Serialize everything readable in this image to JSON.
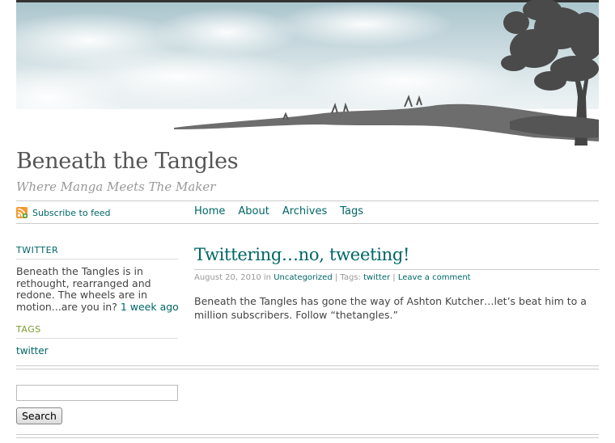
{
  "site": {
    "title": "Beneath the Tangles",
    "tagline": "Where Manga Meets The Maker"
  },
  "feed": {
    "label": "Subscribe to feed",
    "icon": "rss-feed-icon"
  },
  "nav": {
    "items": [
      {
        "label": "Home"
      },
      {
        "label": "About"
      },
      {
        "label": "Archives"
      },
      {
        "label": "Tags"
      }
    ]
  },
  "sidebar": {
    "twitter": {
      "title": "TWITTER",
      "text": "Beneath the Tangles is in rethought, rearranged and redone. The wheels are in motion...are you in?",
      "time_link": "1 week ago"
    },
    "tags": {
      "title": "TAGS",
      "items": [
        {
          "label": "twitter"
        }
      ]
    }
  },
  "post": {
    "title": "Twittering…no, tweeting!",
    "date": "August 20, 2010",
    "in_label": "in",
    "category": "Uncategorized",
    "tags_label": "| Tags:",
    "tag": "twitter",
    "comment_link": "Leave a comment",
    "body": "Beneath the Tangles has gone the way of Ashton Kutcher…let’s beat him to a million subscribers.    Follow “thetangles.”"
  },
  "search": {
    "value": "",
    "button_label": "Search"
  },
  "colors": {
    "link": "#006666",
    "tags_heading": "#7a9c2a",
    "title": "#555555",
    "tagline": "#999999"
  }
}
